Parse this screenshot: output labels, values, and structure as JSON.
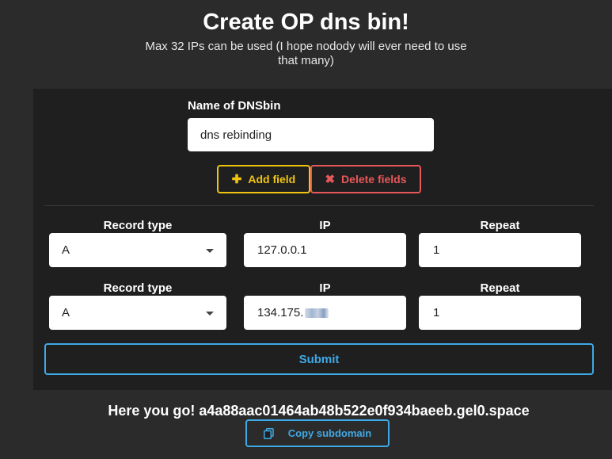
{
  "header": {
    "title": "Create OP dns bin!",
    "subtitle": "Max 32 IPs can be used (I hope nodody will ever need to use that many)"
  },
  "form": {
    "name_label": "Name of DNSbin",
    "name_value": "dns rebinding",
    "add_field_label": "Add field",
    "delete_fields_label": "Delete fields",
    "columns": {
      "record_type": "Record type",
      "ip": "IP",
      "repeat": "Repeat"
    },
    "rows": [
      {
        "record_type": "A",
        "ip": "127.0.0.1",
        "repeat": "1"
      },
      {
        "record_type": "A",
        "ip": "134.175.",
        "repeat": "1"
      }
    ],
    "submit_label": "Submit"
  },
  "result": {
    "text": "Here you go! a4a88aac01464ab48b522e0f934baeeb.gel0.space",
    "copy_label": "Copy subdomain"
  },
  "icons": {
    "add": "plus-icon",
    "delete": "x-icon",
    "copy": "copy-icon"
  },
  "colors": {
    "add": "#f1c40f",
    "delete": "#e8575a",
    "primary": "#3fa9e6"
  }
}
